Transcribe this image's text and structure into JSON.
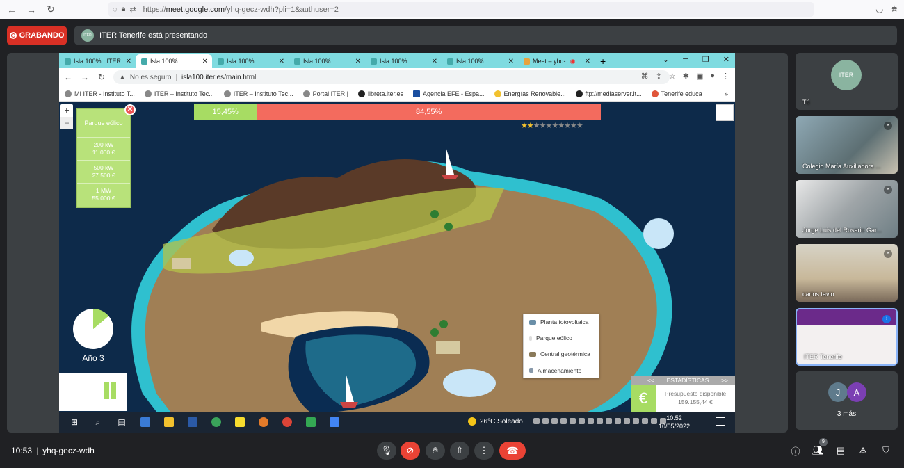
{
  "firefox": {
    "url_host": "meet.google.com",
    "url_prefix": "https://",
    "url_path": "/yhq-gecz-wdh?pli=1&authuser=2"
  },
  "meet_top": {
    "recording_label": "GRABANDO",
    "presenting_text": "ITER Tenerife está presentando",
    "presenter_avatar": "ITER"
  },
  "chrome": {
    "tabs": [
      {
        "label": "Isla 100% · ITER"
      },
      {
        "label": "Isla 100%"
      },
      {
        "label": "Isla 100%"
      },
      {
        "label": "Isla 100%"
      },
      {
        "label": "Isla 100%"
      },
      {
        "label": "Isla 100%"
      },
      {
        "label": "Meet – yhq-"
      }
    ],
    "not_secure": "No es seguro",
    "url": "isla100.iter.es/main.html",
    "bookmarks": [
      "MI ITER - Instituto T...",
      "ITER – Instituto Tec...",
      "ITER – Instituto Tec...",
      "Portal ITER |",
      "libreta.iter.es",
      "Agencia EFE - Espa...",
      "Energías Renovable...",
      "ftp://mediaserver.it...",
      "Tenerife educa"
    ]
  },
  "game": {
    "renewable_pct": "15,45%",
    "nonrenewable_pct": "84,55%",
    "renewable_fraction": 0.1545,
    "stars_filled": 1.5,
    "stars_total": 10,
    "wind_panel": {
      "title": "Parque eólico",
      "options": [
        {
          "power": "200 kW",
          "cost": "11.000 €"
        },
        {
          "power": "500 kW",
          "cost": "27.500 €"
        },
        {
          "power": "1 MW",
          "cost": "55.000 €"
        }
      ]
    },
    "year_label": "Año 3",
    "year_progress": 0.14,
    "menu": [
      "Planta fotovoltaica",
      "Parque eólico",
      "Central geotérmica",
      "Almacenamiento"
    ],
    "stats": {
      "header": "ESTADÍSTICAS",
      "budget_label": "Presupuesto disponible",
      "budget_value": "159.155,44 €"
    }
  },
  "taskbar": {
    "weather": "26°C  Soleado",
    "time": "10:52",
    "date": "10/05/2022"
  },
  "participants": {
    "self": {
      "name": "Tú",
      "avatar": "ITER"
    },
    "tiles": [
      {
        "name": "Colegio María Auxiliadora ..."
      },
      {
        "name": "Jorge Luis del Rosario Gar..."
      },
      {
        "name": "carlos tavio"
      },
      {
        "name": "ITER Tenerife"
      }
    ],
    "more": {
      "avatars": [
        "J",
        "A"
      ],
      "label": "3 más"
    }
  },
  "bottom_bar": {
    "time": "10:53",
    "meeting_code": "yhq-gecz-wdh",
    "participants_count": "9"
  },
  "colors": {
    "accent_green": "#a7dc63",
    "accent_red": "#f36b5e",
    "meet_red": "#ea4335"
  }
}
